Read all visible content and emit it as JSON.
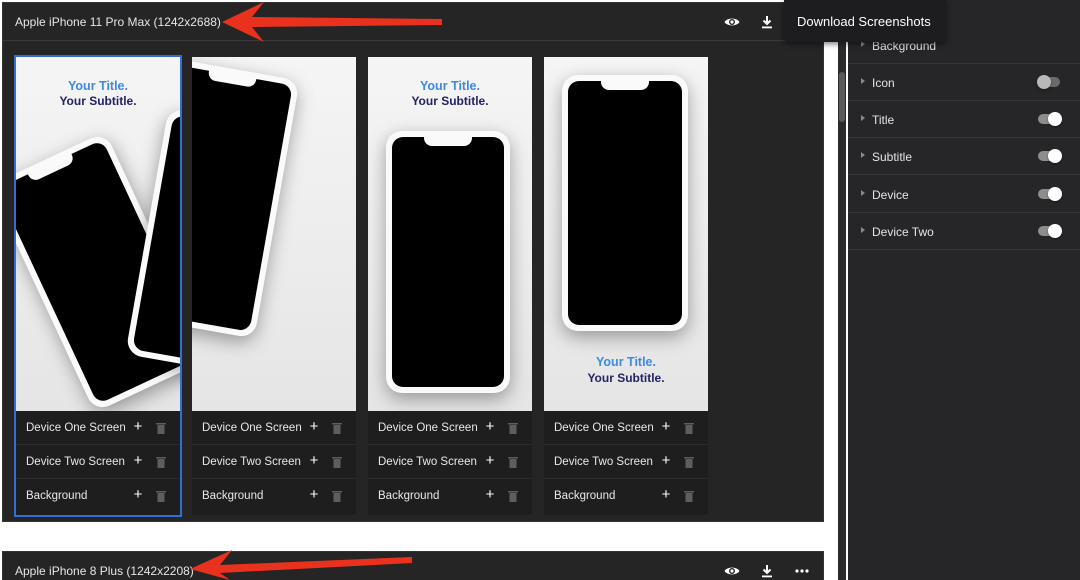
{
  "devices": [
    {
      "title": "Apple iPhone 11 Pro Max (1242x2688)",
      "screens": [
        {
          "preview": {
            "title": "Your Title.",
            "subtitle": "Your Subtitle."
          },
          "rows": [
            {
              "label": "Device One Screen"
            },
            {
              "label": "Device Two Screen"
            },
            {
              "label": "Background"
            }
          ],
          "selected": true
        },
        {
          "preview": {
            "title": "",
            "subtitle": ""
          },
          "rows": [
            {
              "label": "Device One Screen"
            },
            {
              "label": "Device Two Screen"
            },
            {
              "label": "Background"
            }
          ]
        },
        {
          "preview": {
            "title": "Your Title.",
            "subtitle": "Your Subtitle."
          },
          "rows": [
            {
              "label": "Device One Screen"
            },
            {
              "label": "Device Two Screen"
            },
            {
              "label": "Background"
            }
          ]
        },
        {
          "preview": {
            "title": "Your Title.",
            "subtitle": "Your Subtitle."
          },
          "rows": [
            {
              "label": "Device One Screen"
            },
            {
              "label": "Device Two Screen"
            },
            {
              "label": "Background"
            }
          ]
        }
      ]
    },
    {
      "title": "Apple iPhone 8 Plus (1242x2208)"
    }
  ],
  "header_icons": [
    "eye-icon",
    "download-icon",
    "more-icon"
  ],
  "tooltip": {
    "text": "Download Screenshots"
  },
  "layers": [
    {
      "label": "Background",
      "toggle": null
    },
    {
      "label": "Icon",
      "toggle": false
    },
    {
      "label": "Title",
      "toggle": true
    },
    {
      "label": "Subtitle",
      "toggle": true
    },
    {
      "label": "Device",
      "toggle": true
    },
    {
      "label": "Device Two",
      "toggle": true
    }
  ],
  "colors": {
    "panel_bg": "#252526",
    "selected_outline": "#2f6fd6",
    "preview_title": "#3d8ae6",
    "preview_subtitle": "#222266",
    "annotation_arrow": "#e8321e"
  }
}
